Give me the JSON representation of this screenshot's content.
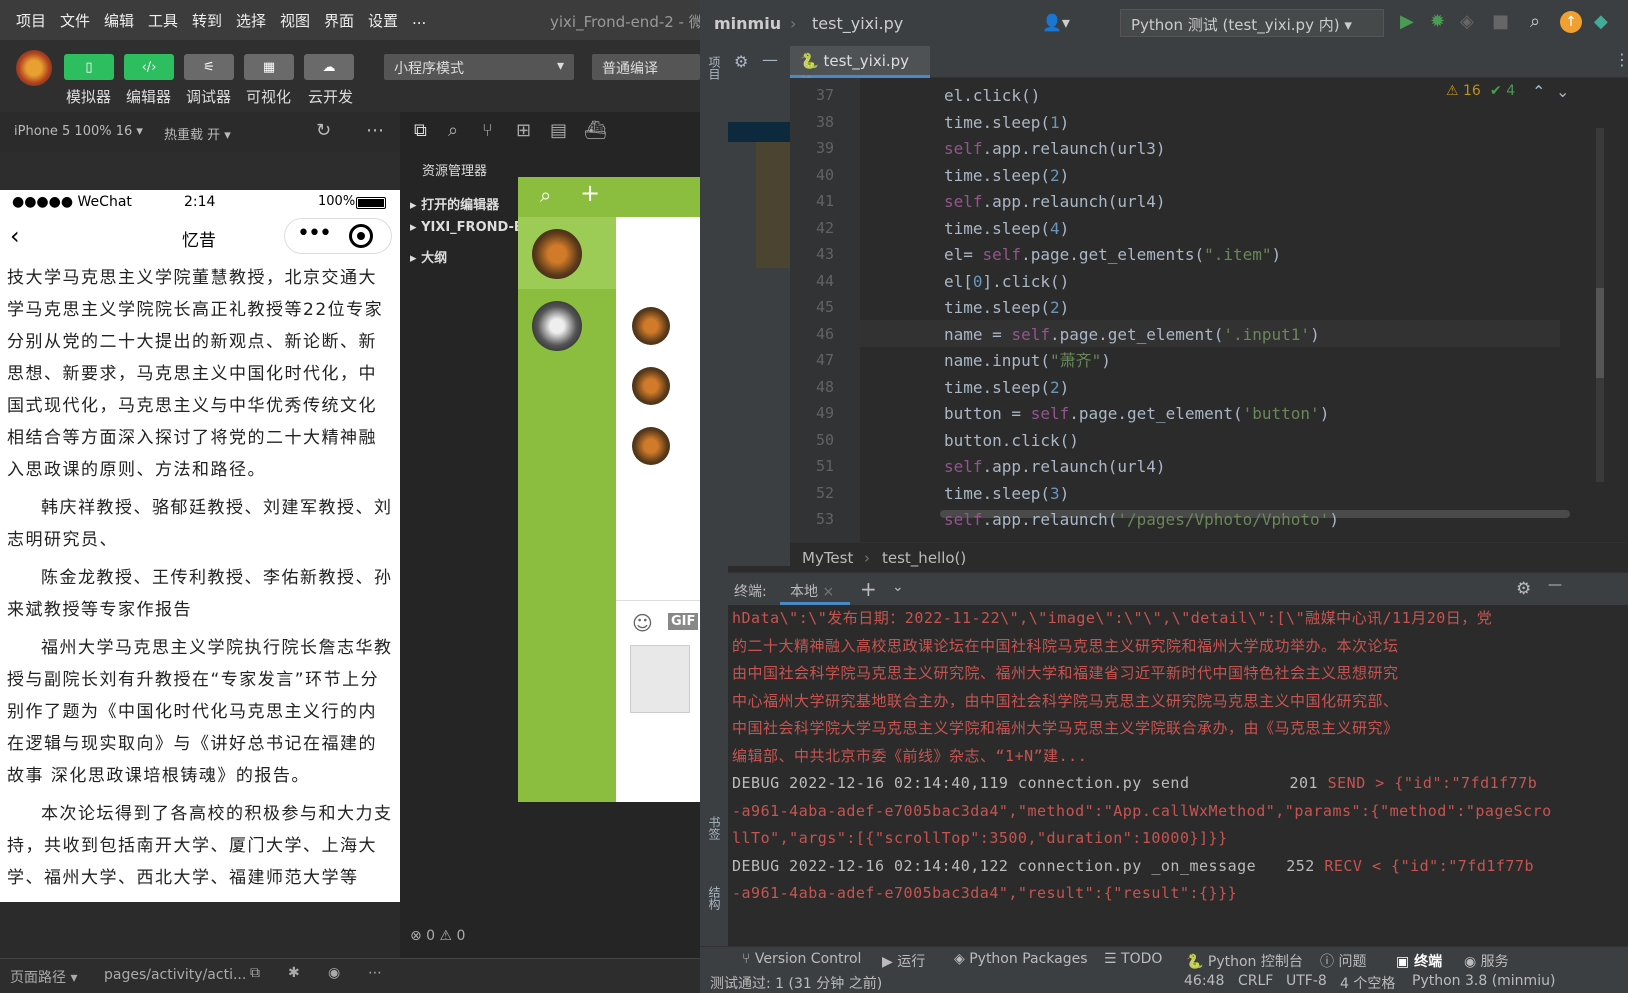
{
  "wx": {
    "menu": [
      "项目",
      "文件",
      "编辑",
      "工具",
      "转到",
      "选择",
      "视图",
      "界面",
      "设置",
      "..."
    ],
    "window_title": "yixi_Frond-end-2 - 微",
    "toolbar": {
      "simulator": "模拟器",
      "editor": "编辑器",
      "debugger": "调试器",
      "visual": "可视化",
      "cloud": "云开发",
      "mode": "小程序模式",
      "compile": "普通编译"
    },
    "sim": {
      "device": "iPhone 5 100% 16 ▾",
      "hotreload": "热重载 开 ▾"
    },
    "phone": {
      "carrier": "●●●●● WeChat",
      "time": "2:14",
      "battery": "100%",
      "title": "忆昔"
    },
    "article": [
      "技大学马克思主义学院董慧教授，北京交通大学马克思主义学院院长高正礼教授等22位专家分别从党的二十大提出的新观点、新论断、新思想、新要求，马克思主义中国化时代化，中国式现代化，马克思主义与中华优秀传统文化相结合等方面深入探讨了将党的二十大精神融入思政课的原则、方法和路径。",
      "韩庆祥教授、骆郁廷教授、刘建军教授、刘志明研究员、",
      "陈金龙教授、王传利教授、李佑新教授、孙来斌教授等专家作报告",
      "福州大学马克思主义学院执行院长詹志华教授与副院长刘有升教授在“专家发言”环节上分别作了题为《中国化时代化马克思主义行的内在逻辑与现实取向》与《讲好总书记在福建的故事 深化思政课培根铸魂》的报告。",
      "本次论坛得到了各高校的积极参与和大力支持，共收到包括南开大学、厦门大学、上海大学、福州大学、西北大学、福建师范大学等"
    ],
    "explorer": {
      "title": "资源管理器",
      "items": [
        "打开的编辑器",
        "YIXI_FROND-E",
        "大纲"
      ]
    },
    "path": {
      "label": "页面路径 ▾",
      "value": "pages/activity/acti..."
    },
    "errors": "⊗ 0 ⚠ 0"
  },
  "pc": {
    "project": "minmiu",
    "file": "test_yixi.py",
    "run_config": "Python 测试 (test_yixi.py 内)",
    "tab": "test_yixi.py",
    "warnings": "16",
    "checks": "4",
    "lines": [
      {
        "n": "37",
        "t": "el.click()"
      },
      {
        "n": "38",
        "t": "time.sleep(1)"
      },
      {
        "n": "39",
        "t": "self.app.relaunch(url3)"
      },
      {
        "n": "40",
        "t": "time.sleep(2)"
      },
      {
        "n": "41",
        "t": "self.app.relaunch(url4)"
      },
      {
        "n": "42",
        "t": "time.sleep(4)"
      },
      {
        "n": "43",
        "t": "el= self.page.get_elements(\".item\")"
      },
      {
        "n": "44",
        "t": "el[0].click()"
      },
      {
        "n": "45",
        "t": "time.sleep(2)"
      },
      {
        "n": "46",
        "t": "name = self.page.get_element('.input1')"
      },
      {
        "n": "47",
        "t": "name.input(\"萧齐\")"
      },
      {
        "n": "48",
        "t": "time.sleep(2)"
      },
      {
        "n": "49",
        "t": "button = self.page.get_element('button')"
      },
      {
        "n": "50",
        "t": "button.click()"
      },
      {
        "n": "51",
        "t": "self.app.relaunch(url4)"
      },
      {
        "n": "52",
        "t": "time.sleep(3)"
      },
      {
        "n": "53",
        "t": "self.app.relaunch('/pages/Vphoto/Vphoto')"
      }
    ],
    "breadcrumb": [
      "MyTest",
      "test_hello()"
    ],
    "terminal": {
      "label": "终端:",
      "tab": "本地",
      "lines": [
        "hData\\\":\\\"发布日期：2022-11-22\\\",\\\"image\\\":\\\"\\\",\\\"detail\\\":[\\\"融媒中心讯/11月20日，党",
        "的二十大精神融入高校思政课论坛在中国社科院马克思主义研究院和福州大学成功举办。本次论坛",
        "由中国社会科学院马克思主义研究院、福州大学和福建省习近平新时代中国特色社会主义思想研究",
        "中心福州大学研究基地联合主办，由中国社会科学院马克思主义研究院马克思主义中国化研究部、",
        "中国社会科学院大学马克思主义学院和福州大学马克思主义学院联合承办，由《马克思主义研究》",
        "编辑部、中共北京市委《前线》杂志、“1+N”建..."
      ],
      "debug1": "DEBUG 2022-12-16 02:14:40,119 connection.py send",
      "debug1_code": "201",
      "debug1_kind": "SEND > {\"id\":\"7fd1f77b",
      "debug1_cont": "-a961-4aba-adef-e7005bac3da4\",\"method\":\"App.callWxMethod\",\"params\":{\"method\":\"pageScro",
      "debug1_cont2": "llTo\",\"args\":[{\"scrollTop\":3500,\"duration\":10000}]}}",
      "debug2": "DEBUG 2022-12-16 02:14:40,122 connection.py _on_message",
      "debug2_code": "252",
      "debug2_kind": "RECV < {\"id\":\"7fd1f77b",
      "debug2_cont": "-a961-4aba-adef-e7005bac3da4\",\"result\":{\"result\":{}}}"
    },
    "tools": [
      "Version Control",
      "运行",
      "Python Packages",
      "TODO",
      "Python 控制台",
      "问题",
      "终端",
      "服务"
    ],
    "status": {
      "left": "测试通过: 1 (31 分钟 之前)",
      "pos": "46:48",
      "eol": "CRLF",
      "enc": "UTF-8",
      "indent": "4 个空格",
      "interp": "Python 3.8 (minmiu)"
    },
    "side": {
      "project": "项目",
      "bookmarks": "书签",
      "structure": "结构"
    }
  }
}
